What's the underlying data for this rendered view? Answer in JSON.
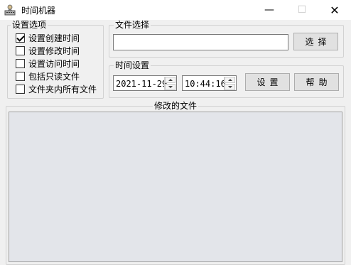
{
  "window": {
    "title": "时间机器",
    "minimize_glyph": "—",
    "maximize_glyph": "☐",
    "close_glyph": "✕",
    "app_icon": "keyboard-user-icon"
  },
  "settings_group": {
    "title": "设置选项",
    "options": [
      {
        "label": "设置创建时间",
        "checked": true
      },
      {
        "label": "设置修改时间",
        "checked": false
      },
      {
        "label": "设置访问时间",
        "checked": false
      },
      {
        "label": "包括只读文件",
        "checked": false
      },
      {
        "label": "文件夹内所有文件",
        "checked": false
      }
    ]
  },
  "file_group": {
    "title": "文件选择",
    "path_value": "",
    "select_button": "选择"
  },
  "time_group": {
    "title": "时间设置",
    "date_value": "2021-11-29",
    "time_value": "10:44:16",
    "set_button": "设置",
    "help_button": "帮助"
  },
  "modified_files": {
    "title": "修改的文件"
  }
}
